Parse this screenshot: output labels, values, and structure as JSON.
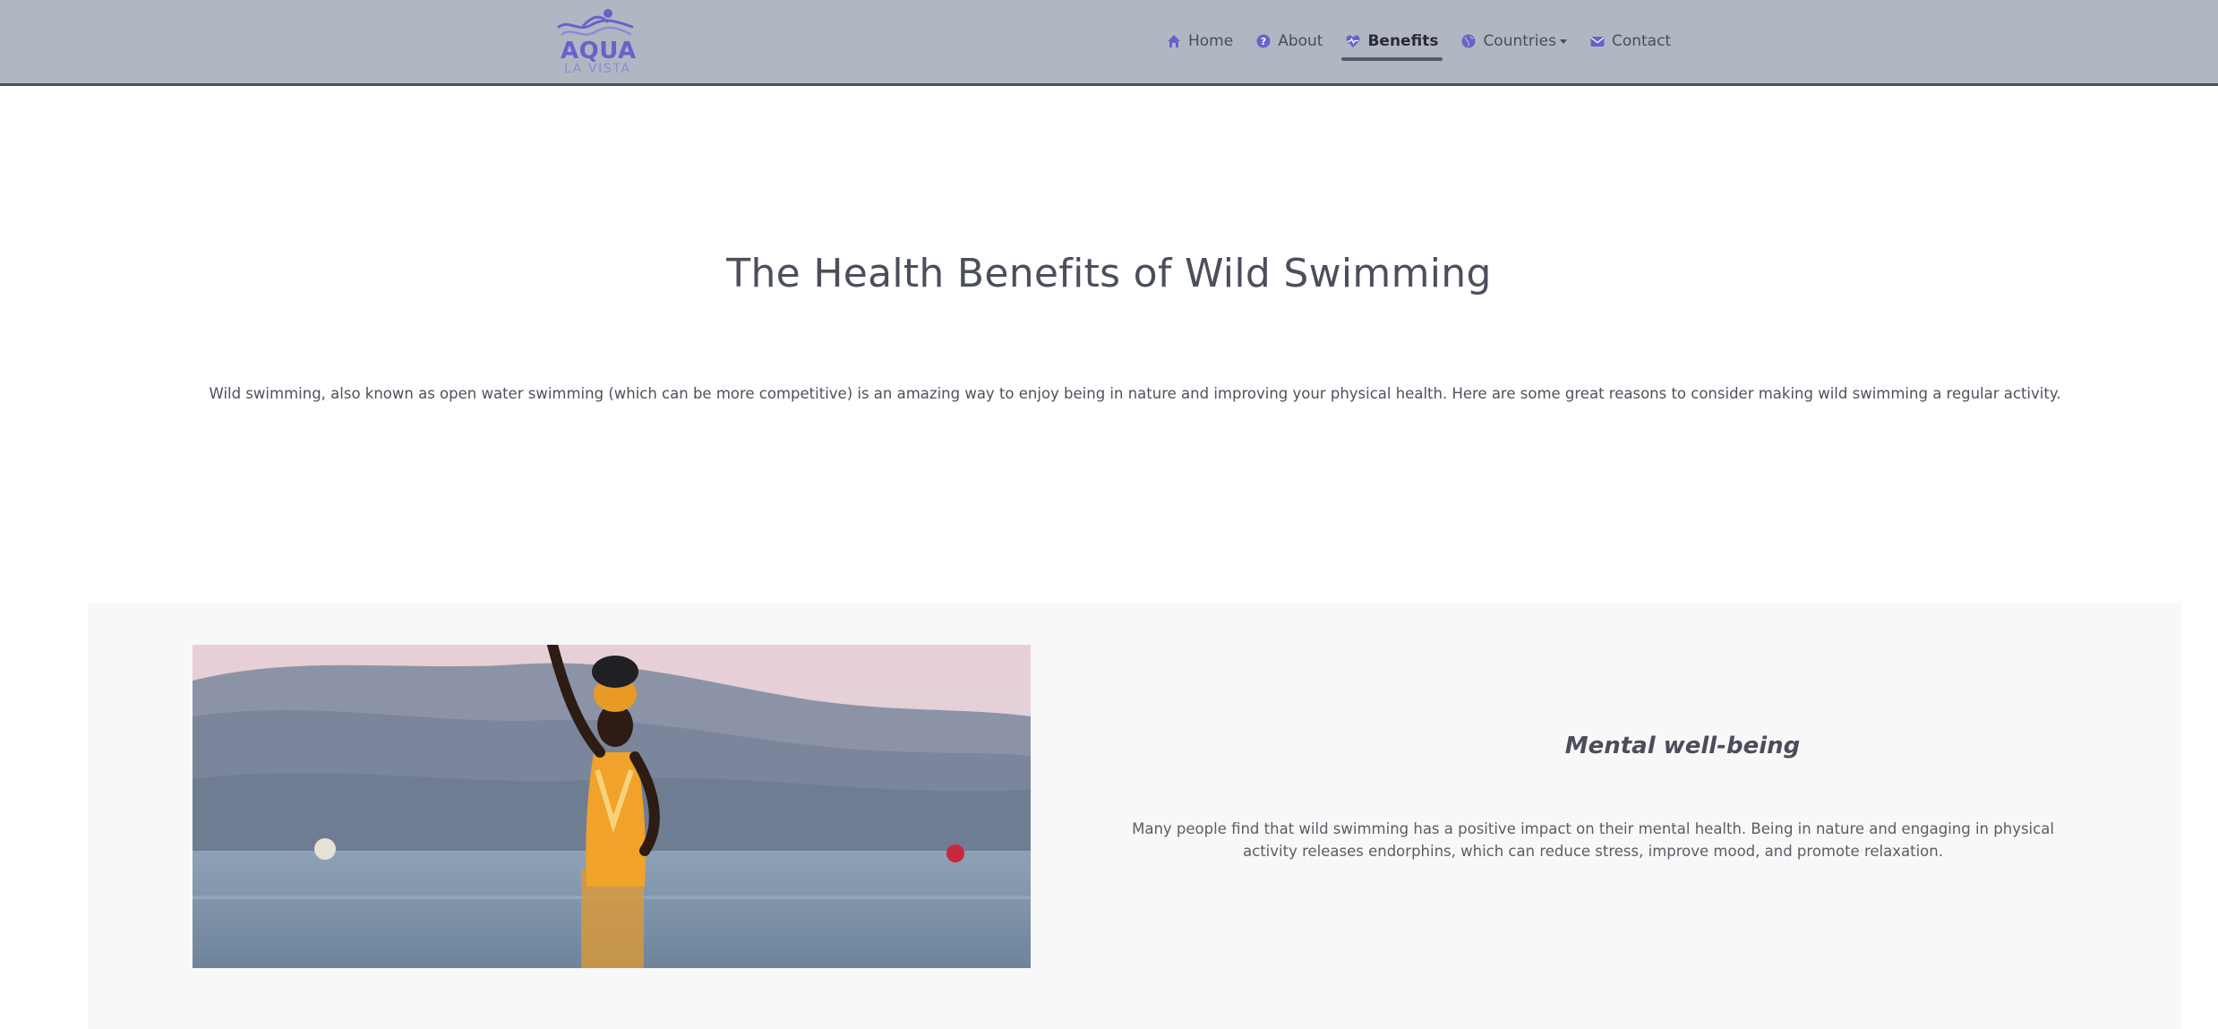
{
  "brand": {
    "name": "AQUA",
    "tagline": "LA VISTA"
  },
  "nav": {
    "items": [
      {
        "label": "Home",
        "icon": "home-icon"
      },
      {
        "label": "About",
        "icon": "question-circle-icon"
      },
      {
        "label": "Benefits",
        "icon": "heart-pulse-icon",
        "active": true
      },
      {
        "label": "Countries",
        "icon": "globe-icon",
        "dropdown": true
      },
      {
        "label": "Contact",
        "icon": "envelope-icon"
      }
    ]
  },
  "hero": {
    "title": "The Health Benefits of Wild Swimming",
    "intro": "Wild swimming, also known as open water swimming (which can be more competitive) is an amazing way to enjoy being in nature and improving your physical health. Here are some great reasons to consider making wild swimming a regular activity."
  },
  "feature": {
    "heading": "Mental well-being",
    "text": "Many people find that wild swimming has a positive impact on their mental health. Being in nature and engaging in physical activity releases endorphins, which can reduce stress, improve mood, and promote relaxation."
  },
  "colors": {
    "navbar_bg": "#b0b7c3",
    "brand_purple": "#6a62c9",
    "section_bg": "#f8f8f8"
  }
}
